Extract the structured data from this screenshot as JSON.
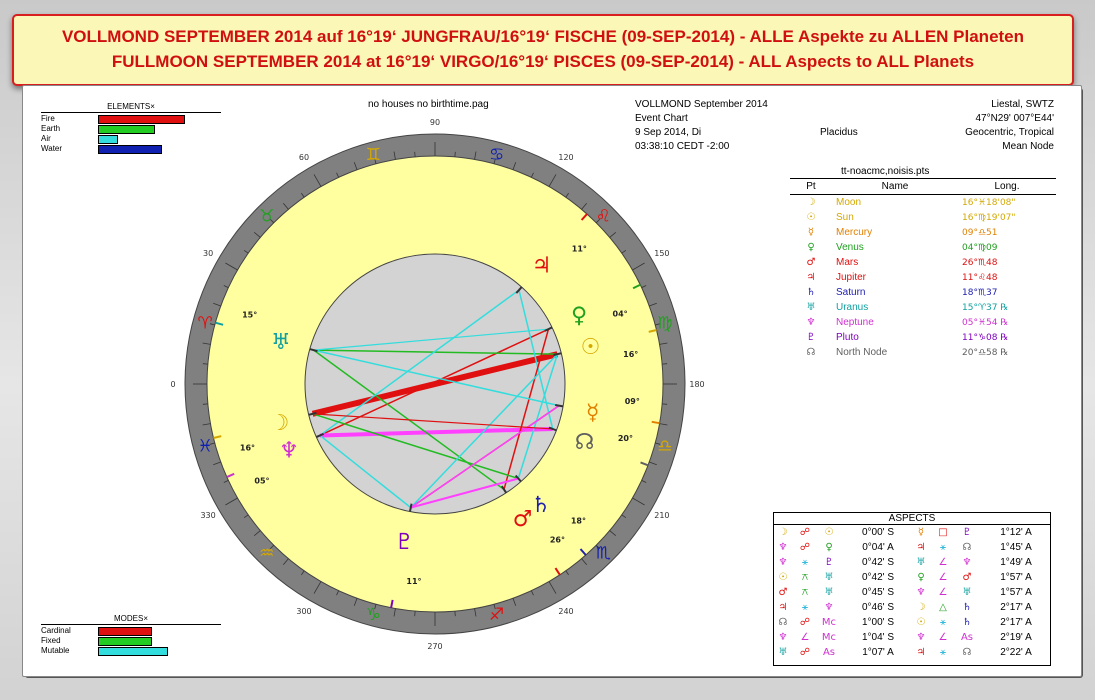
{
  "banner": {
    "line1": "VOLLMOND SEPTEMBER 2014 auf 16°19‘ JUNGFRAU/16°19‘ FISCHE (09-SEP-2014) - ALLE Aspekte zu ALLEN Planeten",
    "line2": "FULLMOON SEPTEMBER 2014 at 16°19‘ VIRGO/16°19‘ PISCES (09-SEP-2014) - ALL Aspects to ALL Planets"
  },
  "header": {
    "file": "no houses no birthtime.pag",
    "title": "VOLLMOND September 2014",
    "chart_type": "Event Chart",
    "date": "9 Sep 2014, Di",
    "time": "03:38:10 CEDT -2:00",
    "house_system": "Placidus",
    "location": "Liestal, SWTZ",
    "coords": "47°N29' 007°E44'",
    "zodiac": "Geocentric, Tropical",
    "node": "Mean Node",
    "points_file": "tt-noacmc,noisis.pts"
  },
  "elements": {
    "title": "ELEMENTS×",
    "items": [
      {
        "label": "Fire",
        "value": 0.85,
        "color": "#e01010"
      },
      {
        "label": "Earth",
        "value": 0.55,
        "color": "#22cc22"
      },
      {
        "label": "Air",
        "value": 0.18,
        "color": "#33dddd"
      },
      {
        "label": "Water",
        "value": 0.62,
        "color": "#1020b0"
      }
    ]
  },
  "modes": {
    "title": "MODES×",
    "items": [
      {
        "label": "Cardinal",
        "value": 0.52,
        "color": "#e01010"
      },
      {
        "label": "Fixed",
        "value": 0.52,
        "color": "#22cc22"
      },
      {
        "label": "Mutable",
        "value": 0.68,
        "color": "#33dddd"
      }
    ]
  },
  "points_table": {
    "headers": [
      "Pt",
      "Name",
      "Long."
    ],
    "rows": [
      {
        "glyph": "☽",
        "name": "Moon",
        "long": "16°♓18'08\"",
        "color": "#d4a800"
      },
      {
        "glyph": "☉",
        "name": "Sun",
        "long": "16°♍19'07\"",
        "color": "#d4a800"
      },
      {
        "glyph": "☿",
        "name": "Mercury",
        "long": "09°♎51",
        "color": "#e08000"
      },
      {
        "glyph": "♀",
        "name": "Venus",
        "long": "04°♍09",
        "color": "#20a020"
      },
      {
        "glyph": "♂",
        "name": "Mars",
        "long": "26°♏48",
        "color": "#e01010"
      },
      {
        "glyph": "♃",
        "name": "Jupiter",
        "long": "11°♌48",
        "color": "#e01010"
      },
      {
        "glyph": "♄",
        "name": "Saturn",
        "long": "18°♏37",
        "color": "#2020b0"
      },
      {
        "glyph": "♅",
        "name": "Uranus",
        "long": "15°♈37 ℞",
        "color": "#10a0a0"
      },
      {
        "glyph": "♆",
        "name": "Neptune",
        "long": "05°♓54 ℞",
        "color": "#d030d0"
      },
      {
        "glyph": "♇",
        "name": "Pluto",
        "long": "11°♑08 ℞",
        "color": "#8000c0"
      },
      {
        "glyph": "☊",
        "name": "North Node",
        "long": "20°♎58 ℞",
        "color": "#606060"
      }
    ]
  },
  "aspects": {
    "title": "ASPECTS",
    "left": [
      {
        "p1": "☽",
        "a": "☍",
        "p2": "☉",
        "orb": "0°00' S",
        "c1": "#d4a800",
        "ca": "#e01010",
        "c2": "#d4a800"
      },
      {
        "p1": "♆",
        "a": "☍",
        "p2": "♀",
        "orb": "0°04' A",
        "c1": "#d030d0",
        "ca": "#e01010",
        "c2": "#20a020"
      },
      {
        "p1": "♆",
        "a": "⚹",
        "p2": "♇",
        "orb": "0°42' S",
        "c1": "#d030d0",
        "ca": "#33bbdd",
        "c2": "#8000c0"
      },
      {
        "p1": "☉",
        "a": "⚻",
        "p2": "♅",
        "orb": "0°42' S",
        "c1": "#d4a800",
        "ca": "#20a020",
        "c2": "#10a0a0"
      },
      {
        "p1": "♂",
        "a": "⚻",
        "p2": "♅",
        "orb": "0°45' S",
        "c1": "#e01010",
        "ca": "#20a020",
        "c2": "#10a0a0"
      },
      {
        "p1": "♃",
        "a": "⚹",
        "p2": "♆",
        "orb": "0°46' S",
        "c1": "#e01010",
        "ca": "#33bbdd",
        "c2": "#d030d0"
      },
      {
        "p1": "☊",
        "a": "☍",
        "p2": "Mc",
        "orb": "1°00' S",
        "c1": "#606060",
        "ca": "#e01010",
        "c2": "#d030d0"
      },
      {
        "p1": "♆",
        "a": "∠",
        "p2": "Mc",
        "orb": "1°04' S",
        "c1": "#d030d0",
        "ca": "#d030d0",
        "c2": "#d030d0"
      },
      {
        "p1": "♅",
        "a": "☍",
        "p2": "As",
        "orb": "1°07' A",
        "c1": "#10a0a0",
        "ca": "#e01010",
        "c2": "#d030d0"
      }
    ],
    "right": [
      {
        "p1": "☿",
        "a": "□",
        "p2": "♇",
        "orb": "1°12' A",
        "c1": "#e08000",
        "ca": "#e01010",
        "c2": "#8000c0"
      },
      {
        "p1": "♃",
        "a": "⚹",
        "p2": "☊",
        "orb": "1°45' A",
        "c1": "#e01010",
        "ca": "#33bbdd",
        "c2": "#606060"
      },
      {
        "p1": "♅",
        "a": "∠",
        "p2": "♆",
        "orb": "1°49' A",
        "c1": "#10a0a0",
        "ca": "#d030d0",
        "c2": "#d030d0"
      },
      {
        "p1": "♀",
        "a": "∠",
        "p2": "♂",
        "orb": "1°57' A",
        "c1": "#20a020",
        "ca": "#d030d0",
        "c2": "#e01010"
      },
      {
        "p1": "♆",
        "a": "∠",
        "p2": "♅",
        "orb": "1°57' A",
        "c1": "#d030d0",
        "ca": "#d030d0",
        "c2": "#10a0a0"
      },
      {
        "p1": "☽",
        "a": "△",
        "p2": "♄",
        "orb": "2°17' A",
        "c1": "#d4a800",
        "ca": "#20a020",
        "c2": "#2020b0"
      },
      {
        "p1": "☉",
        "a": "⚹",
        "p2": "♄",
        "orb": "2°17' A",
        "c1": "#d4a800",
        "ca": "#33bbdd",
        "c2": "#2020b0"
      },
      {
        "p1": "♆",
        "a": "∠",
        "p2": "As",
        "orb": "2°19' A",
        "c1": "#d030d0",
        "ca": "#d030d0",
        "c2": "#d030d0"
      },
      {
        "p1": "♃",
        "a": "⚹",
        "p2": "☊",
        "orb": "2°22' A",
        "c1": "#e01010",
        "ca": "#33bbdd",
        "c2": "#606060"
      }
    ]
  },
  "wheel": {
    "degree_marks": [
      "0",
      "30",
      "60",
      "90",
      "120",
      "150",
      "180",
      "210",
      "240",
      "270",
      "300",
      "330"
    ],
    "signs": [
      {
        "glyph": "♈",
        "color": "#e01010"
      },
      {
        "glyph": "♉",
        "color": "#20a020"
      },
      {
        "glyph": "♊",
        "color": "#d4a800"
      },
      {
        "glyph": "♋",
        "color": "#1020b0"
      },
      {
        "glyph": "♌",
        "color": "#e01010"
      },
      {
        "glyph": "♍",
        "color": "#20a020"
      },
      {
        "glyph": "♎",
        "color": "#d4a800"
      },
      {
        "glyph": "♏",
        "color": "#1020b0"
      },
      {
        "glyph": "♐",
        "color": "#e01010"
      },
      {
        "glyph": "♑",
        "color": "#20a020"
      },
      {
        "glyph": "♒",
        "color": "#d4a800"
      },
      {
        "glyph": "♓",
        "color": "#1020b0"
      }
    ],
    "planets": [
      {
        "glyph": "☽",
        "lon": 346.3,
        "label": "16°",
        "color": "#d4a800"
      },
      {
        "glyph": "☉",
        "lon": 166.3,
        "label": "16°",
        "color": "#d4a800"
      },
      {
        "glyph": "☿",
        "lon": 189.9,
        "label": "09°",
        "color": "#e08000"
      },
      {
        "glyph": "♀",
        "lon": 154.2,
        "label": "04°",
        "color": "#20a020"
      },
      {
        "glyph": "♂",
        "lon": 236.8,
        "label": "26°",
        "color": "#e01010"
      },
      {
        "glyph": "♃",
        "lon": 131.8,
        "label": "11°",
        "color": "#e01010"
      },
      {
        "glyph": "♄",
        "lon": 228.6,
        "label": "18°",
        "color": "#2020b0"
      },
      {
        "glyph": "♅",
        "lon": 15.6,
        "label": "15°",
        "color": "#10a0a0"
      },
      {
        "glyph": "♆",
        "lon": 335.9,
        "label": "05°",
        "color": "#d030d0"
      },
      {
        "glyph": "♇",
        "lon": 281.1,
        "label": "11°",
        "color": "#8000c0"
      },
      {
        "glyph": "☊",
        "lon": 200.9,
        "label": "20°",
        "color": "#606060"
      }
    ],
    "aspect_lines": [
      {
        "a": 346.3,
        "b": 166.3,
        "color": "#e01010",
        "w": 6
      },
      {
        "a": 335.9,
        "b": 154.2,
        "color": "#e01010",
        "w": 1.5
      },
      {
        "a": 335.9,
        "b": 200.9,
        "color": "#ff40ff",
        "w": 4
      },
      {
        "a": 335.9,
        "b": 281.1,
        "color": "#33dddd",
        "w": 1.5
      },
      {
        "a": 166.3,
        "b": 15.6,
        "color": "#22bb22",
        "w": 1.5
      },
      {
        "a": 236.8,
        "b": 15.6,
        "color": "#22bb22",
        "w": 1.5
      },
      {
        "a": 131.8,
        "b": 335.9,
        "color": "#33dddd",
        "w": 1.5
      },
      {
        "a": 189.9,
        "b": 281.1,
        "color": "#e01010",
        "w": 1.5
      },
      {
        "a": 131.8,
        "b": 200.9,
        "color": "#33dddd",
        "w": 1.5
      },
      {
        "a": 154.2,
        "b": 236.8,
        "color": "#e01010",
        "w": 1.5
      },
      {
        "a": 346.3,
        "b": 228.6,
        "color": "#22bb22",
        "w": 1.5
      },
      {
        "a": 166.3,
        "b": 228.6,
        "color": "#33dddd",
        "w": 1.5
      },
      {
        "a": 281.1,
        "b": 228.6,
        "color": "#ff40ff",
        "w": 2
      },
      {
        "a": 281.1,
        "b": 166.3,
        "color": "#33dddd",
        "w": 1.5
      },
      {
        "a": 15.6,
        "b": 189.9,
        "color": "#33dddd",
        "w": 1.5
      },
      {
        "a": 281.1,
        "b": 189.9,
        "color": "#ff40ff",
        "w": 1.5
      },
      {
        "a": 346.3,
        "b": 200.9,
        "color": "#e01010",
        "w": 1.2
      },
      {
        "a": 15.6,
        "b": 154.2,
        "color": "#33dddd",
        "w": 1.2
      }
    ]
  }
}
